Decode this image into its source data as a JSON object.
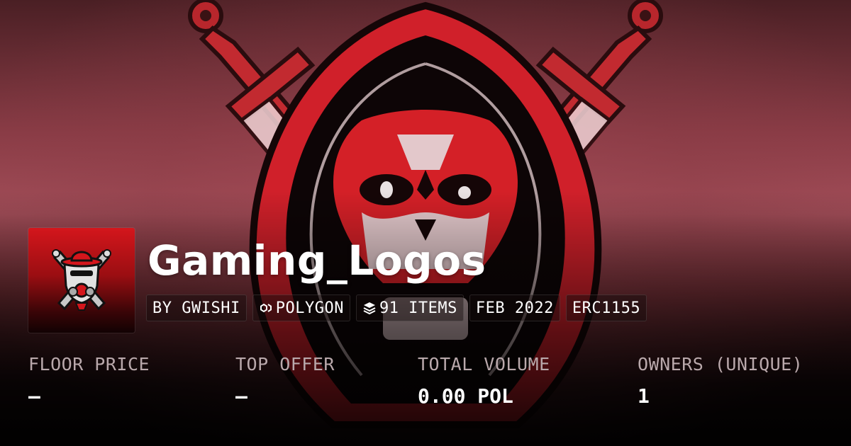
{
  "collection": {
    "title": "Gaming_Logos",
    "tags": [
      {
        "label": "BY GWISHI",
        "icon": ""
      },
      {
        "label": "POLYGON",
        "icon": "polygon-chain-icon"
      },
      {
        "label": "91 ITEMS",
        "icon": "layers-stack-icon"
      },
      {
        "label": "FEB 2022",
        "icon": ""
      },
      {
        "label": "ERC1155",
        "icon": ""
      }
    ]
  },
  "stats": [
    {
      "label": "FLOOR PRICE",
      "value": "–"
    },
    {
      "label": "TOP OFFER",
      "value": "–"
    },
    {
      "label": "TOTAL VOLUME",
      "value": "0.00 POL"
    },
    {
      "label": "OWNERS (UNIQUE)",
      "value": "1"
    }
  ],
  "colors": {
    "accent_red": "#d4161c",
    "background_top": "#4a1f24",
    "background_mid": "#a44f5a",
    "label_gray": "#b9a8ab",
    "text_white": "#ffffff"
  }
}
